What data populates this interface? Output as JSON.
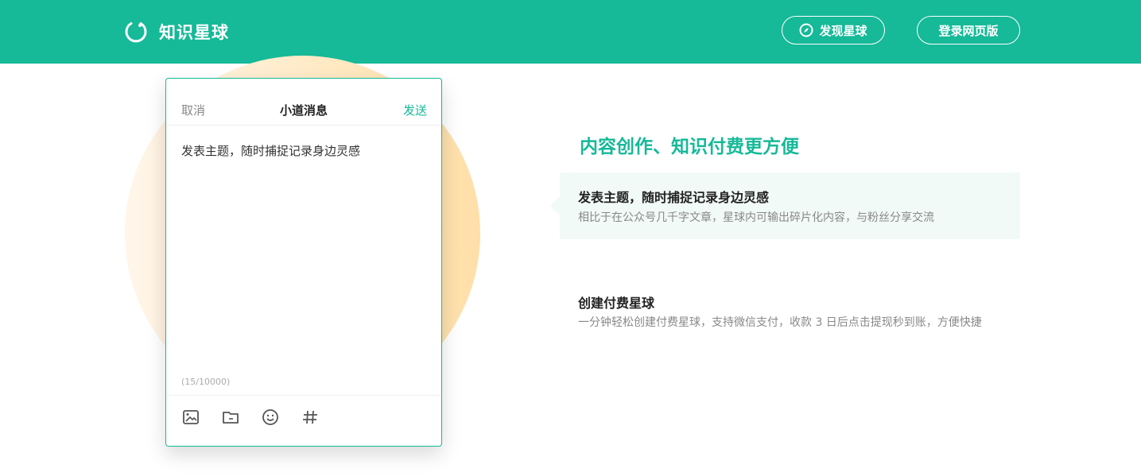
{
  "header": {
    "brand": "知识星球",
    "discover_label": "发现星球",
    "login_label": "登录网页版",
    "bg_color": "#16b998"
  },
  "card": {
    "cancel_label": "取消",
    "title": "小道消息",
    "send_label": "发送",
    "content": "发表主题，随时捕捉记录身边灵感",
    "counter": "(15/10000)",
    "tools": [
      "image-icon",
      "folder-icon",
      "emoji-icon",
      "hashtag-icon"
    ]
  },
  "main": {
    "section_title": "内容创作、知识付费更方便",
    "features": [
      {
        "title": "发表主题，随时捕捉记录身边灵感",
        "desc": "相比于在公众号几千字文章，星球内可输出碎片化内容，与粉丝分享交流"
      },
      {
        "title": "创建付费星球",
        "desc": "一分钟轻松创建付费星球，支持微信支付，收款 3 日后点击提现秒到账，方便快捷"
      }
    ]
  },
  "colors": {
    "accent": "#16b998",
    "circle": "#ffe3b0"
  }
}
